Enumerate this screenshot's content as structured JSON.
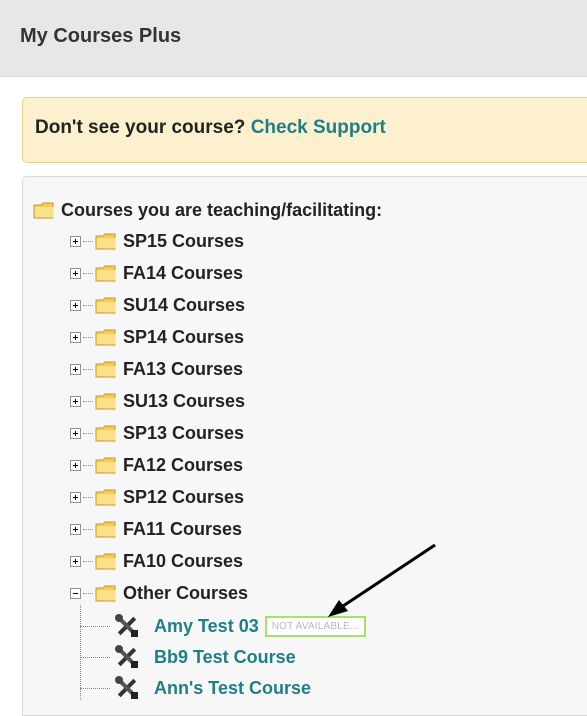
{
  "header": {
    "title": "My Courses Plus"
  },
  "notice": {
    "prefix": "Don't see your course?",
    "link": "Check Support"
  },
  "tree": {
    "root_label": "Courses you are teaching/facilitating:",
    "folders": [
      {
        "label": "SP15 Courses",
        "expanded": false
      },
      {
        "label": "FA14 Courses",
        "expanded": false
      },
      {
        "label": "SU14 Courses",
        "expanded": false
      },
      {
        "label": "SP14 Courses",
        "expanded": false
      },
      {
        "label": "FA13 Courses",
        "expanded": false
      },
      {
        "label": "SU13 Courses",
        "expanded": false
      },
      {
        "label": "SP13 Courses",
        "expanded": false
      },
      {
        "label": "FA12 Courses",
        "expanded": false
      },
      {
        "label": "SP12 Courses",
        "expanded": false
      },
      {
        "label": "FA11 Courses",
        "expanded": false
      },
      {
        "label": "FA10 Courses",
        "expanded": false
      },
      {
        "label": "Other Courses",
        "expanded": true
      }
    ],
    "courses": [
      {
        "label": "Amy Test 03",
        "badge": "NOT AVAILABLE..."
      },
      {
        "label": "Bb9 Test Course"
      },
      {
        "label": "Ann's Test Course"
      }
    ]
  },
  "colors": {
    "link": "#1d7f87",
    "notice_bg": "#fcf0cf",
    "badge_border": "#a8e06a",
    "header_bg": "#e7e7e7"
  },
  "icons": {
    "folder": "folder-icon",
    "course": "tools-icon",
    "expand": "plus-box-icon",
    "collapse": "minus-box-icon"
  }
}
